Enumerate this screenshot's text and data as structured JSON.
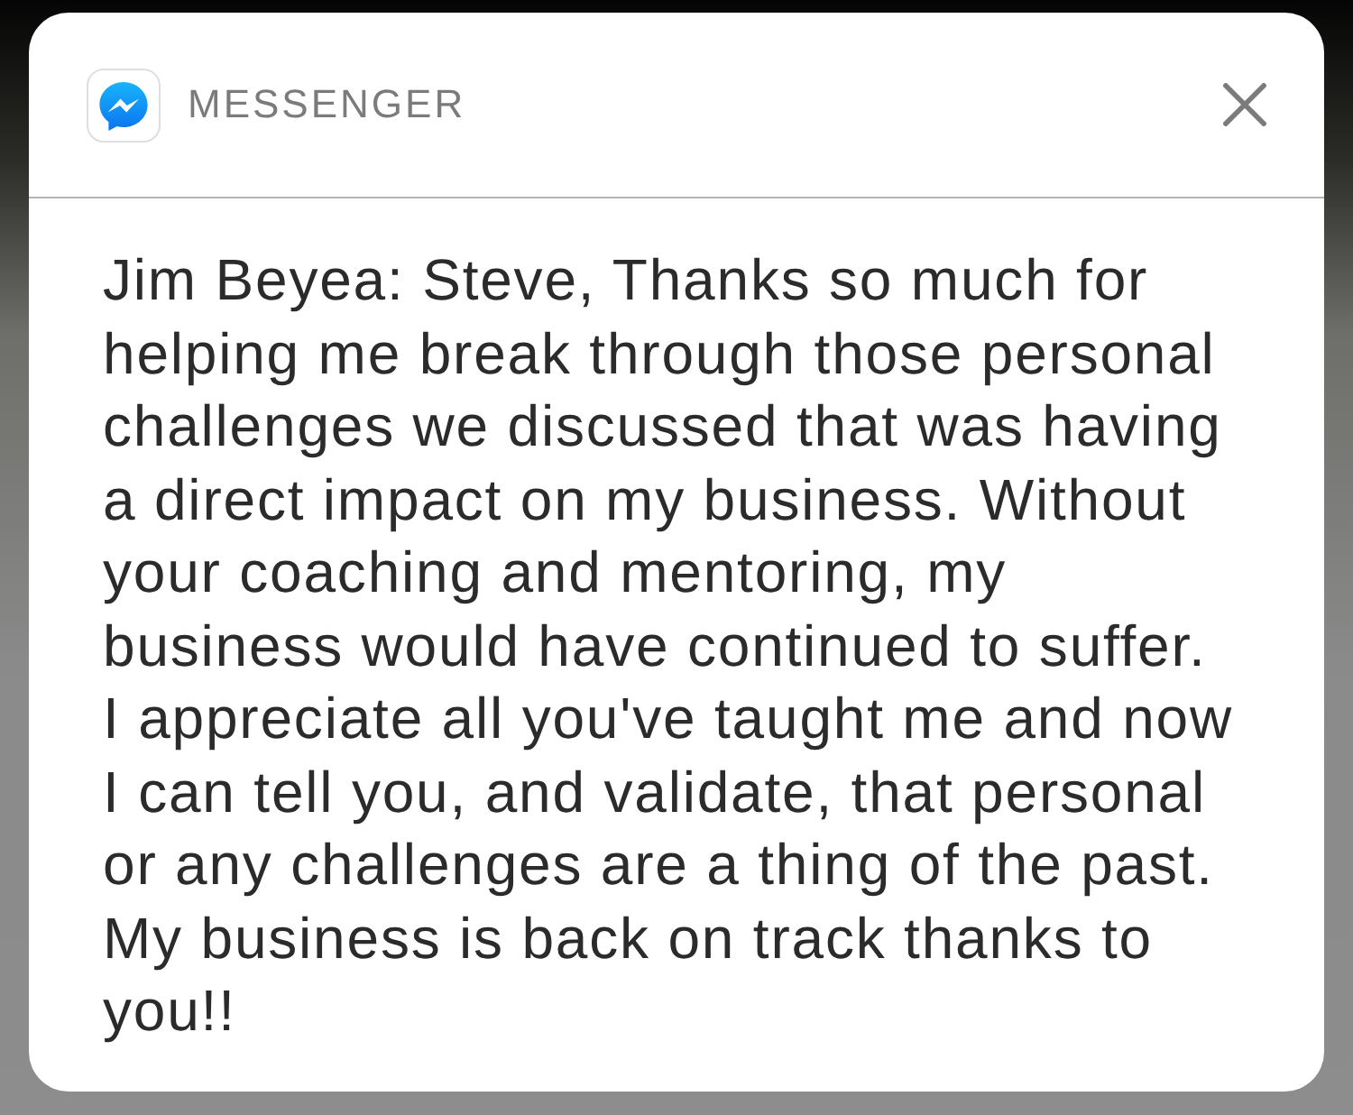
{
  "notification": {
    "app_name": "MESSENGER",
    "message": "Jim Beyea: Steve, Thanks so much for helping me break through those personal challenges we discussed that was having a direct impact on my business. Without your coaching and mentoring, my business would have continued to suffer. I appreciate all you've taught me and now I can tell you, and validate, that personal or any challenges are a thing of the past. My business is back on track thanks to you!!"
  }
}
